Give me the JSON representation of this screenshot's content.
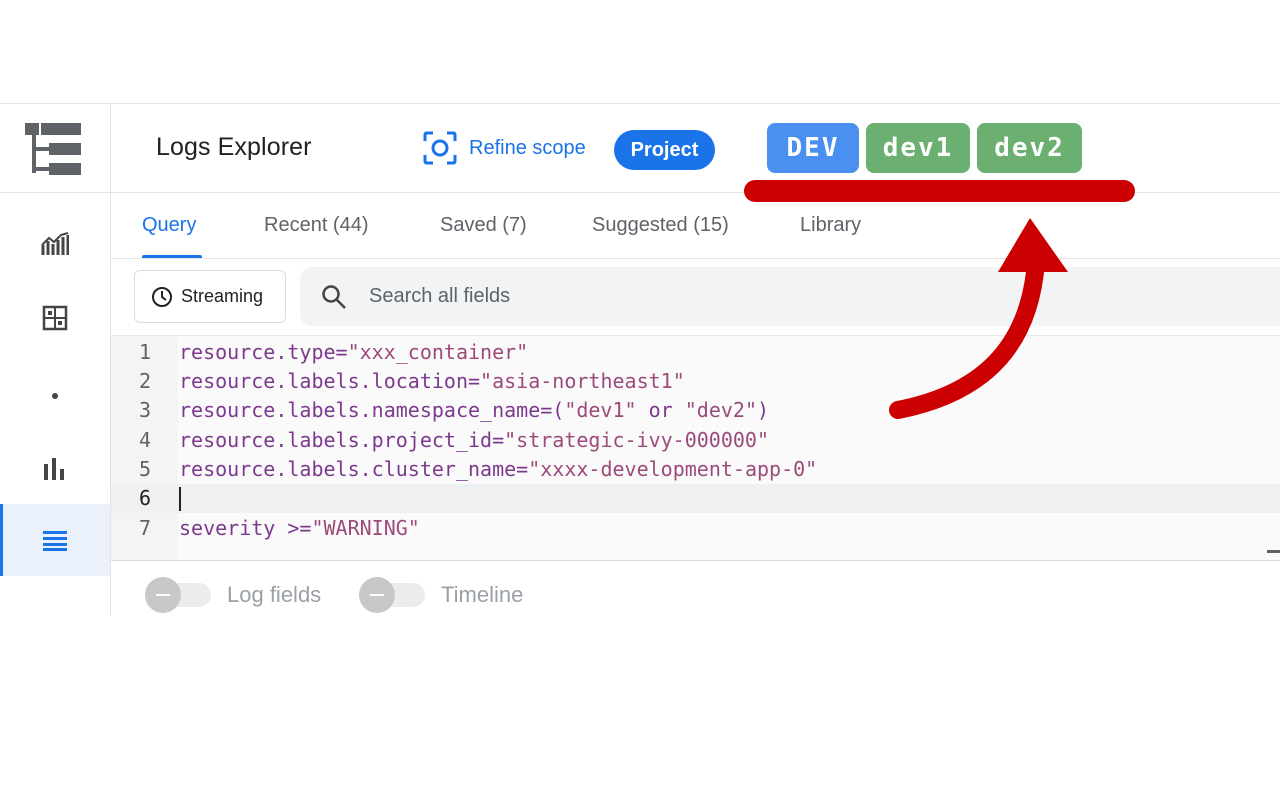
{
  "header": {
    "title": "Logs Explorer",
    "refine_scope_label": "Refine scope",
    "scope_badge": "Project"
  },
  "env_tags": [
    {
      "label": "DEV",
      "color": "#4a90f0"
    },
    {
      "label": "dev1",
      "color": "#6bb070"
    },
    {
      "label": "dev2",
      "color": "#6bb070"
    }
  ],
  "sidebar": {
    "items": [
      {
        "icon": "metrics-icon"
      },
      {
        "icon": "dashboard-icon"
      },
      {
        "icon": "dot-icon"
      },
      {
        "icon": "bar-chart-icon"
      },
      {
        "icon": "logs-list-icon",
        "active": true
      },
      {
        "icon": "logs-search-icon"
      }
    ]
  },
  "tabs": [
    {
      "label": "Query",
      "active": true
    },
    {
      "label": "Recent (44)"
    },
    {
      "label": "Saved (7)"
    },
    {
      "label": "Suggested (15)"
    },
    {
      "label": "Library"
    }
  ],
  "toolbar": {
    "streaming_label": "Streaming",
    "search_placeholder": "Search all fields"
  },
  "editor": {
    "lines": [
      {
        "num": "1",
        "text": "resource.type=\"xxx_container\""
      },
      {
        "num": "2",
        "text": "resource.labels.location=\"asia-northeast1\""
      },
      {
        "num": "3",
        "text": "resource.labels.namespace_name=(\"dev1\" or \"dev2\")"
      },
      {
        "num": "4",
        "text": "resource.labels.project_id=\"strategic-ivy-000000\""
      },
      {
        "num": "5",
        "text": "resource.labels.cluster_name=\"xxxx-development-app-0\""
      },
      {
        "num": "6",
        "text": "",
        "current": true
      },
      {
        "num": "7",
        "text": "severity >=\"WARNING\""
      }
    ]
  },
  "toggles": [
    {
      "label": "Log fields",
      "on": false
    },
    {
      "label": "Timeline",
      "on": false
    }
  ],
  "colors": {
    "accent": "#1a73e8",
    "annotation": "#cc0000"
  }
}
